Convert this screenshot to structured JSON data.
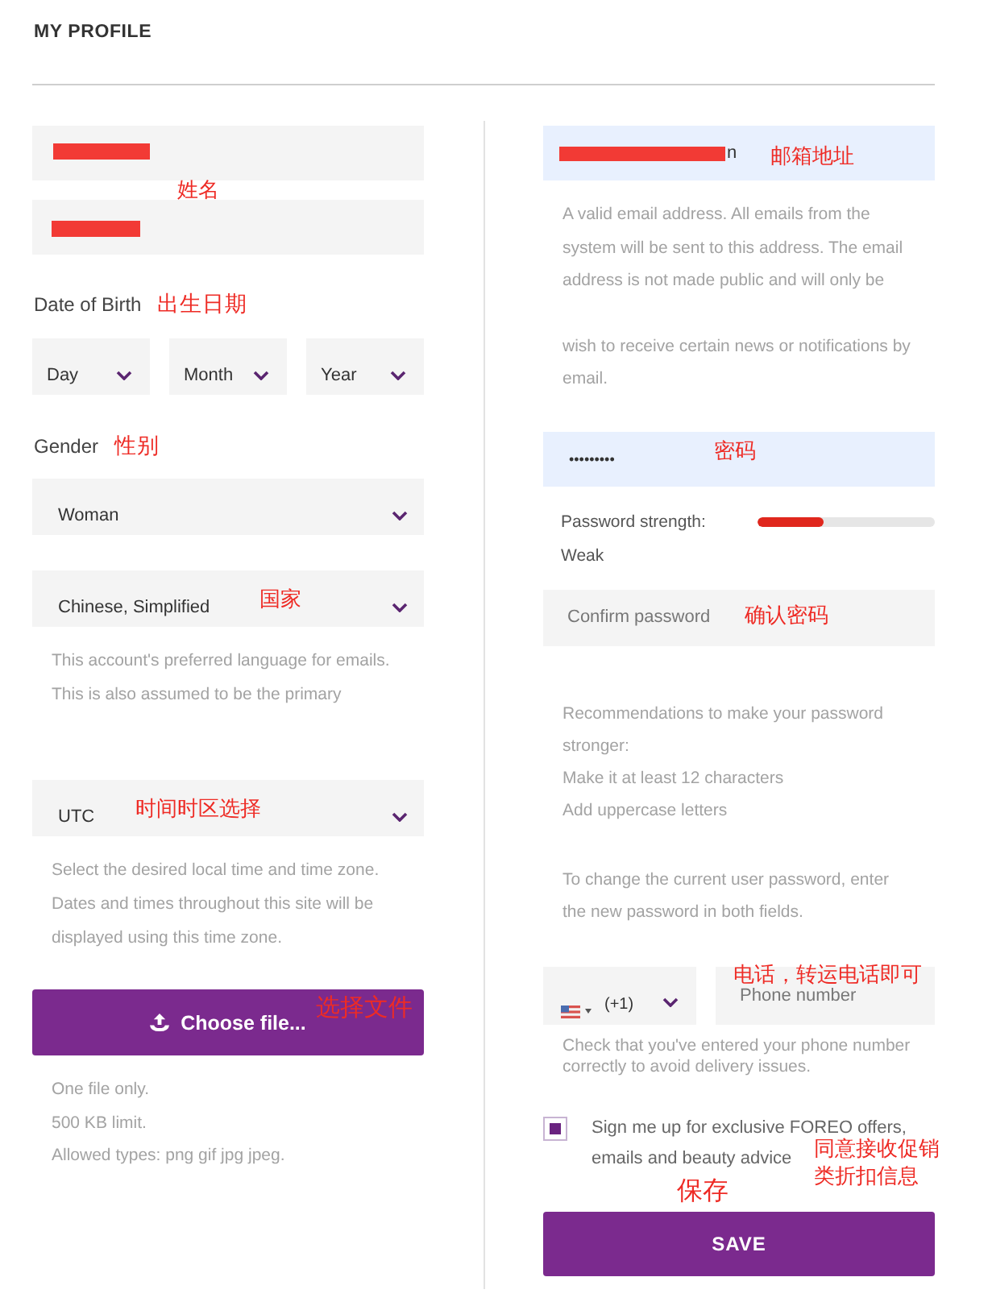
{
  "page": {
    "title": "MY PROFILE"
  },
  "left": {
    "name": {
      "annotation": "姓名",
      "fields": [
        {
          "redacted": true
        },
        {
          "redacted": true
        }
      ]
    },
    "date_of_birth": {
      "label": "Date of Birth",
      "annotation": "出生日期",
      "selects": [
        {
          "value": "Day"
        },
        {
          "value": "Month"
        },
        {
          "value": "Year"
        }
      ]
    },
    "gender": {
      "label": "Gender",
      "annotation": "性别",
      "value": "Woman"
    },
    "language": {
      "value": "Chinese, Simplified",
      "annotation": "国家",
      "help": [
        "This account's preferred language for emails.",
        "This is also assumed to be the primary"
      ]
    },
    "timezone": {
      "value": "UTC",
      "annotation": "时间时区选择",
      "help": [
        "Select the desired local time and time zone.",
        "Dates and times throughout this site will be",
        "displayed using this time zone."
      ]
    },
    "picture": {
      "button": "Choose file...",
      "annotation": "选择文件",
      "help": [
        "One file only.",
        "500 KB limit.",
        "Allowed types: png gif jpg jpeg."
      ]
    }
  },
  "right": {
    "email": {
      "redacted": true,
      "value": "n",
      "annotation": "邮箱地址",
      "help": [
        "A valid email address. All emails from the",
        "system will be sent to this address. The email",
        "address is not made public and will only be"
      ],
      "help_continued": [
        "wish to receive certain news or notifications by",
        "email."
      ]
    },
    "password": {
      "value": "•••••••••",
      "annotation": "密码",
      "strength_label": "Password strength:",
      "level": 0.37,
      "strength": "Weak"
    },
    "confirm_password": {
      "placeholder": "Confirm password",
      "annotation": "确认密码"
    },
    "recommendations": [
      "Recommendations to make your password",
      "stronger:",
      "Make it at least 12 characters",
      "Add uppercase letters"
    ],
    "change_note": [
      "To change the current user password, enter",
      "the new password in both fields."
    ],
    "phone": {
      "country_code": "(+1)",
      "placeholder": "Phone number",
      "annotation": "电话，转运电话即可",
      "help": [
        "Check that you've entered your phone number",
        "correctly to avoid delivery issues."
      ]
    },
    "newsletter": {
      "checked": true,
      "label": [
        "Sign me up for exclusive FOREO offers,",
        "emails and beauty advice"
      ],
      "annotation": "同意接收促销类折扣信息"
    },
    "save": {
      "label": "SAVE",
      "annotation": "保存"
    }
  }
}
